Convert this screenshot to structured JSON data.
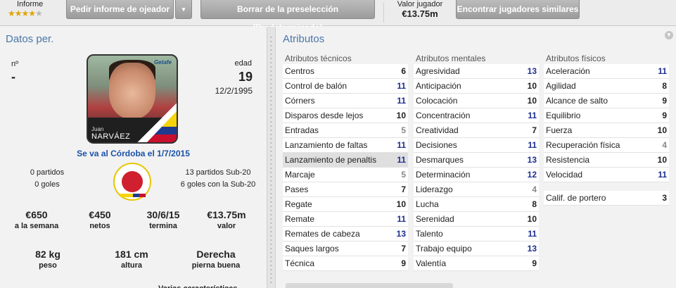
{
  "toolbar": {
    "informe_label": "Informe",
    "stars_on": "★★★★",
    "stars_off": "★",
    "pedir_label": "Pedir informe de ojeador",
    "caret": "▾",
    "borrar_label": "Borrar de la preselección (Predeterminado)",
    "valor_label": "Valor jugador",
    "valor_value": "€13.75m",
    "encontrar_label": "Encontrar jugadores similares"
  },
  "personal": {
    "title": "Datos per.",
    "num_label": "nº",
    "num_value": "-",
    "edad_label": "edad",
    "edad_value": "19",
    "birth_date": "12/2/1995",
    "first_name": "Juan",
    "last_name": "NARVÁEZ",
    "photo_logo": "Getafe",
    "transfer_note": "Se va al Córdoba el 1/7/2015",
    "partidos": "0 partidos",
    "goles": "0 goles",
    "sub20_partidos": "13 partidos Sub-20",
    "sub20_goles": "6 goles con la Sub-20",
    "figures": [
      {
        "value": "€650",
        "label": "a la semana"
      },
      {
        "value": "€450",
        "label": "netos"
      },
      {
        "value": "30/6/15",
        "label": "termina"
      },
      {
        "value": "€13.75m",
        "label": "valor"
      }
    ],
    "body": [
      {
        "value": "82 kg",
        "label": "peso"
      },
      {
        "value": "181 cm",
        "label": "altura"
      },
      {
        "value": "Derecha",
        "label": "pierna buena"
      }
    ],
    "partial_text": "Varias características"
  },
  "atributos": {
    "title": "Atributos",
    "tecnicos_title": "Atributos técnicos",
    "mentales_title": "Atributos mentales",
    "fisicos_title": "Atributos físicos",
    "tecnicos": [
      {
        "name": "Centros",
        "value": "6"
      },
      {
        "name": "Control de balón",
        "value": "11"
      },
      {
        "name": "Córners",
        "value": "11"
      },
      {
        "name": "Disparos desde lejos",
        "value": "10"
      },
      {
        "name": "Entradas",
        "value": "5"
      },
      {
        "name": "Lanzamiento de faltas",
        "value": "11"
      },
      {
        "name": "Lanzamiento de penaltis",
        "value": "11"
      },
      {
        "name": "Marcaje",
        "value": "5"
      },
      {
        "name": "Pases",
        "value": "7"
      },
      {
        "name": "Regate",
        "value": "10"
      },
      {
        "name": "Remate",
        "value": "11"
      },
      {
        "name": "Remates de cabeza",
        "value": "13"
      },
      {
        "name": "Saques largos",
        "value": "7"
      },
      {
        "name": "Técnica",
        "value": "9"
      }
    ],
    "mentales": [
      {
        "name": "Agresividad",
        "value": "13"
      },
      {
        "name": "Anticipación",
        "value": "10"
      },
      {
        "name": "Colocación",
        "value": "10"
      },
      {
        "name": "Concentración",
        "value": "11"
      },
      {
        "name": "Creatividad",
        "value": "7"
      },
      {
        "name": "Decisiones",
        "value": "11"
      },
      {
        "name": "Desmarques",
        "value": "13"
      },
      {
        "name": "Determinación",
        "value": "12"
      },
      {
        "name": "Liderazgo",
        "value": "4"
      },
      {
        "name": "Lucha",
        "value": "8"
      },
      {
        "name": "Serenidad",
        "value": "10"
      },
      {
        "name": "Talento",
        "value": "11"
      },
      {
        "name": "Trabajo equipo",
        "value": "13"
      },
      {
        "name": "Valentía",
        "value": "9"
      }
    ],
    "fisicos": [
      {
        "name": "Aceleración",
        "value": "11"
      },
      {
        "name": "Agilidad",
        "value": "8"
      },
      {
        "name": "Alcance de salto",
        "value": "9"
      },
      {
        "name": "Equilibrio",
        "value": "9"
      },
      {
        "name": "Fuerza",
        "value": "10"
      },
      {
        "name": "Recuperación física",
        "value": "4"
      },
      {
        "name": "Resistencia",
        "value": "10"
      },
      {
        "name": "Velocidad",
        "value": "11"
      }
    ],
    "portero": {
      "name": "Calif. de portero",
      "value": "3"
    }
  }
}
